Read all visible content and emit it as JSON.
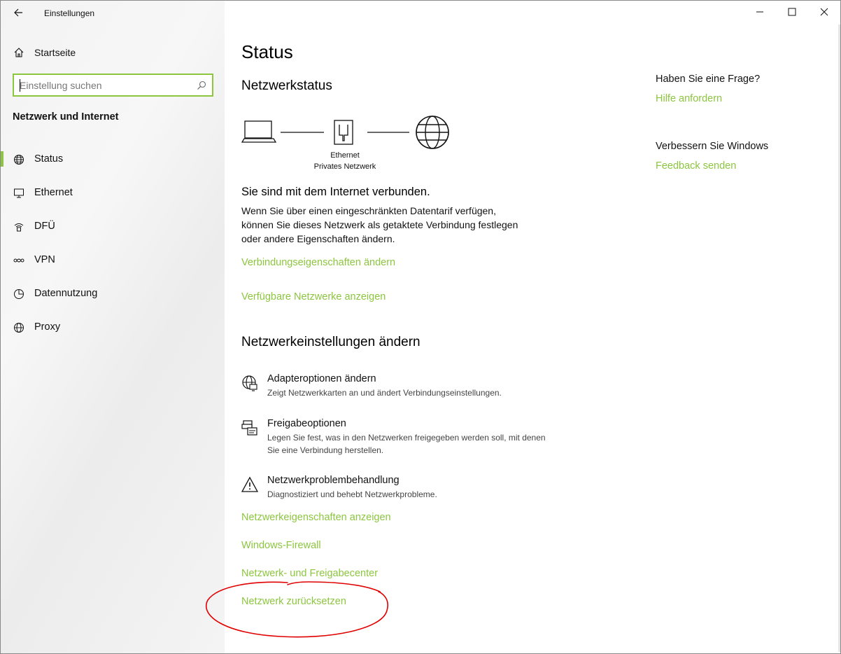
{
  "window": {
    "title": "Einstellungen",
    "controls": {
      "minimize": "—",
      "maximize": "☐",
      "close": "✕"
    }
  },
  "sidebar": {
    "home_label": "Startseite",
    "search_placeholder": "Einstellung suchen",
    "section_title": "Netzwerk und Internet",
    "items": [
      {
        "label": "Status",
        "icon": "globe-icon",
        "active": true
      },
      {
        "label": "Ethernet",
        "icon": "ethernet-icon",
        "active": false
      },
      {
        "label": "DFÜ",
        "icon": "dialup-icon",
        "active": false
      },
      {
        "label": "VPN",
        "icon": "vpn-icon",
        "active": false
      },
      {
        "label": "Datennutzung",
        "icon": "data-usage-icon",
        "active": false
      },
      {
        "label": "Proxy",
        "icon": "globe-icon",
        "active": false
      }
    ]
  },
  "main": {
    "title": "Status",
    "network_status": {
      "heading": "Netzwerkstatus",
      "adapter_label": "Ethernet",
      "network_label": "Privates Netzwerk",
      "connected_text": "Sie sind mit dem Internet verbunden.",
      "description": "Wenn Sie über einen eingeschränkten Datentarif verfügen, können Sie dieses Netzwerk als getaktete Verbindung festlegen oder andere Eigenschaften ändern.",
      "links": {
        "connection_properties": "Verbindungseigenschaften ändern",
        "available_networks": "Verfügbare Netzwerke anzeigen"
      }
    },
    "change_settings": {
      "heading": "Netzwerkeinstellungen ändern",
      "options": [
        {
          "title": "Adapteroptionen ändern",
          "subtitle": "Zeigt Netzwerkkarten an und ändert Verbindungseinstellungen.",
          "icon": "adapter-icon"
        },
        {
          "title": "Freigabeoptionen",
          "subtitle": "Legen Sie fest, was in den Netzwerken freigegeben werden soll, mit denen Sie eine Verbindung herstellen.",
          "icon": "sharing-icon"
        },
        {
          "title": "Netzwerkproblembehandlung",
          "subtitle": "Diagnostiziert und behebt Netzwerkprobleme.",
          "icon": "warning-icon"
        }
      ],
      "links": {
        "network_properties": "Netzwerkeigenschaften anzeigen",
        "firewall": "Windows-Firewall",
        "sharing_center": "Netzwerk- und Freigabecenter",
        "network_reset": "Netzwerk zurücksetzen"
      }
    }
  },
  "aside": {
    "question_heading": "Haben Sie eine Frage?",
    "help_link": "Hilfe anfordern",
    "improve_heading": "Verbessern Sie Windows",
    "feedback_link": "Feedback senden"
  },
  "colors": {
    "accent": "#8cc63f",
    "annotation": "#e00000"
  }
}
